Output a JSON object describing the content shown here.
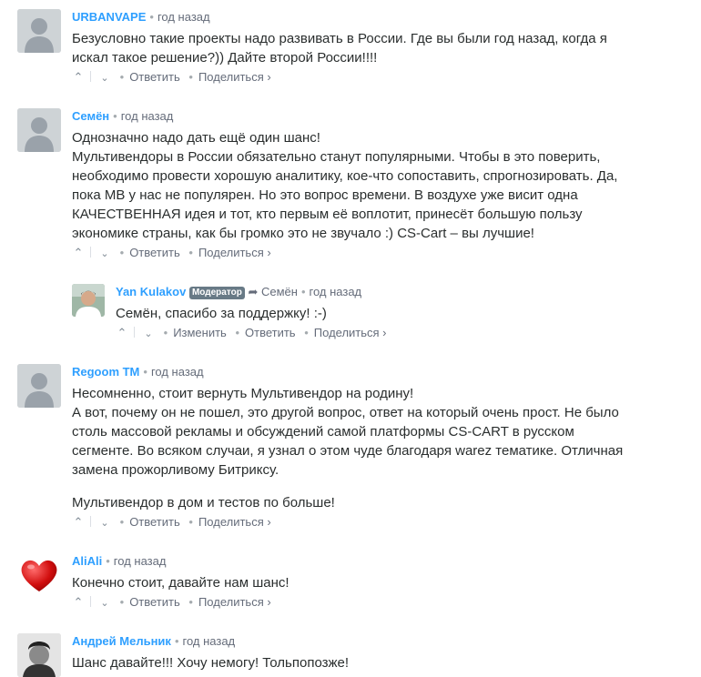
{
  "comments": [
    {
      "author": "URBANVAPE",
      "time": "год назад",
      "body": [
        "Безусловно такие проекты надо развивать в России. Где вы были год назад, когда я искал такое решение?)) Дайте второй России!!!!"
      ],
      "reply": "Ответить",
      "share": "Поделиться ›"
    },
    {
      "author": "Семён",
      "time": "год назад",
      "body": [
        "Однозначно надо дать ещё один шанс!",
        "Мультивендоры в России обязательно станут популярными. Чтобы в это поверить, необходимо провести хорошую аналитику, кое-что сопоставить, спрогнозировать. Да, пока МВ у нас не популярен. Но это вопрос времени. В воздухе уже висит одна КАЧЕСТВЕННАЯ идея и тот, кто первым её воплотит, принесёт большую пользу экономике страны, как бы громко это не звучало :) CS-Cart – вы лучшие!"
      ],
      "reply": "Ответить",
      "share": "Поделиться ›"
    },
    {
      "author": "Yan Kulakov",
      "badge": "Модератор",
      "reply_to": "Семён",
      "time": "год назад",
      "body": [
        "Семён, спасибо за поддержку! :-)"
      ],
      "edit": "Изменить",
      "reply": "Ответить",
      "share": "Поделиться ›"
    },
    {
      "author": "Regoom TM",
      "time": "год назад",
      "body": [
        "Несомненно, стоит вернуть Мультивендор на родину!",
        "А вот, почему он не пошел, это другой вопрос, ответ на который очень прост. Не было столь массовой рекламы и обсуждений самой платформы CS-CART в русском сегменте. Во всяком случаи, я узнал о этом чуде благодаря warez тематике. Отличная замена прожорливому Битриксу.",
        "Мультивендор в дом и тестов по больше!"
      ],
      "reply": "Ответить",
      "share": "Поделиться ›"
    },
    {
      "author": "AliAli",
      "time": "год назад",
      "body": [
        "Конечно стоит, давайте нам шанс!"
      ],
      "reply": "Ответить",
      "share": "Поделиться ›"
    },
    {
      "author": "Андрей Мельник",
      "time": "год назад",
      "body": [
        "Шанс давайте!!! Хочу немогу! Тольпопозже!"
      ]
    }
  ],
  "colors": {
    "author": "#2e9fff",
    "badge_bg": "#687a86",
    "meta": "#656c7a",
    "avatar_placeholder": "#ced3d6"
  },
  "icons": {
    "upvote": "chevron-up-icon",
    "downvote": "chevron-down-icon",
    "reply_arrow": "reply-arrow-icon"
  }
}
